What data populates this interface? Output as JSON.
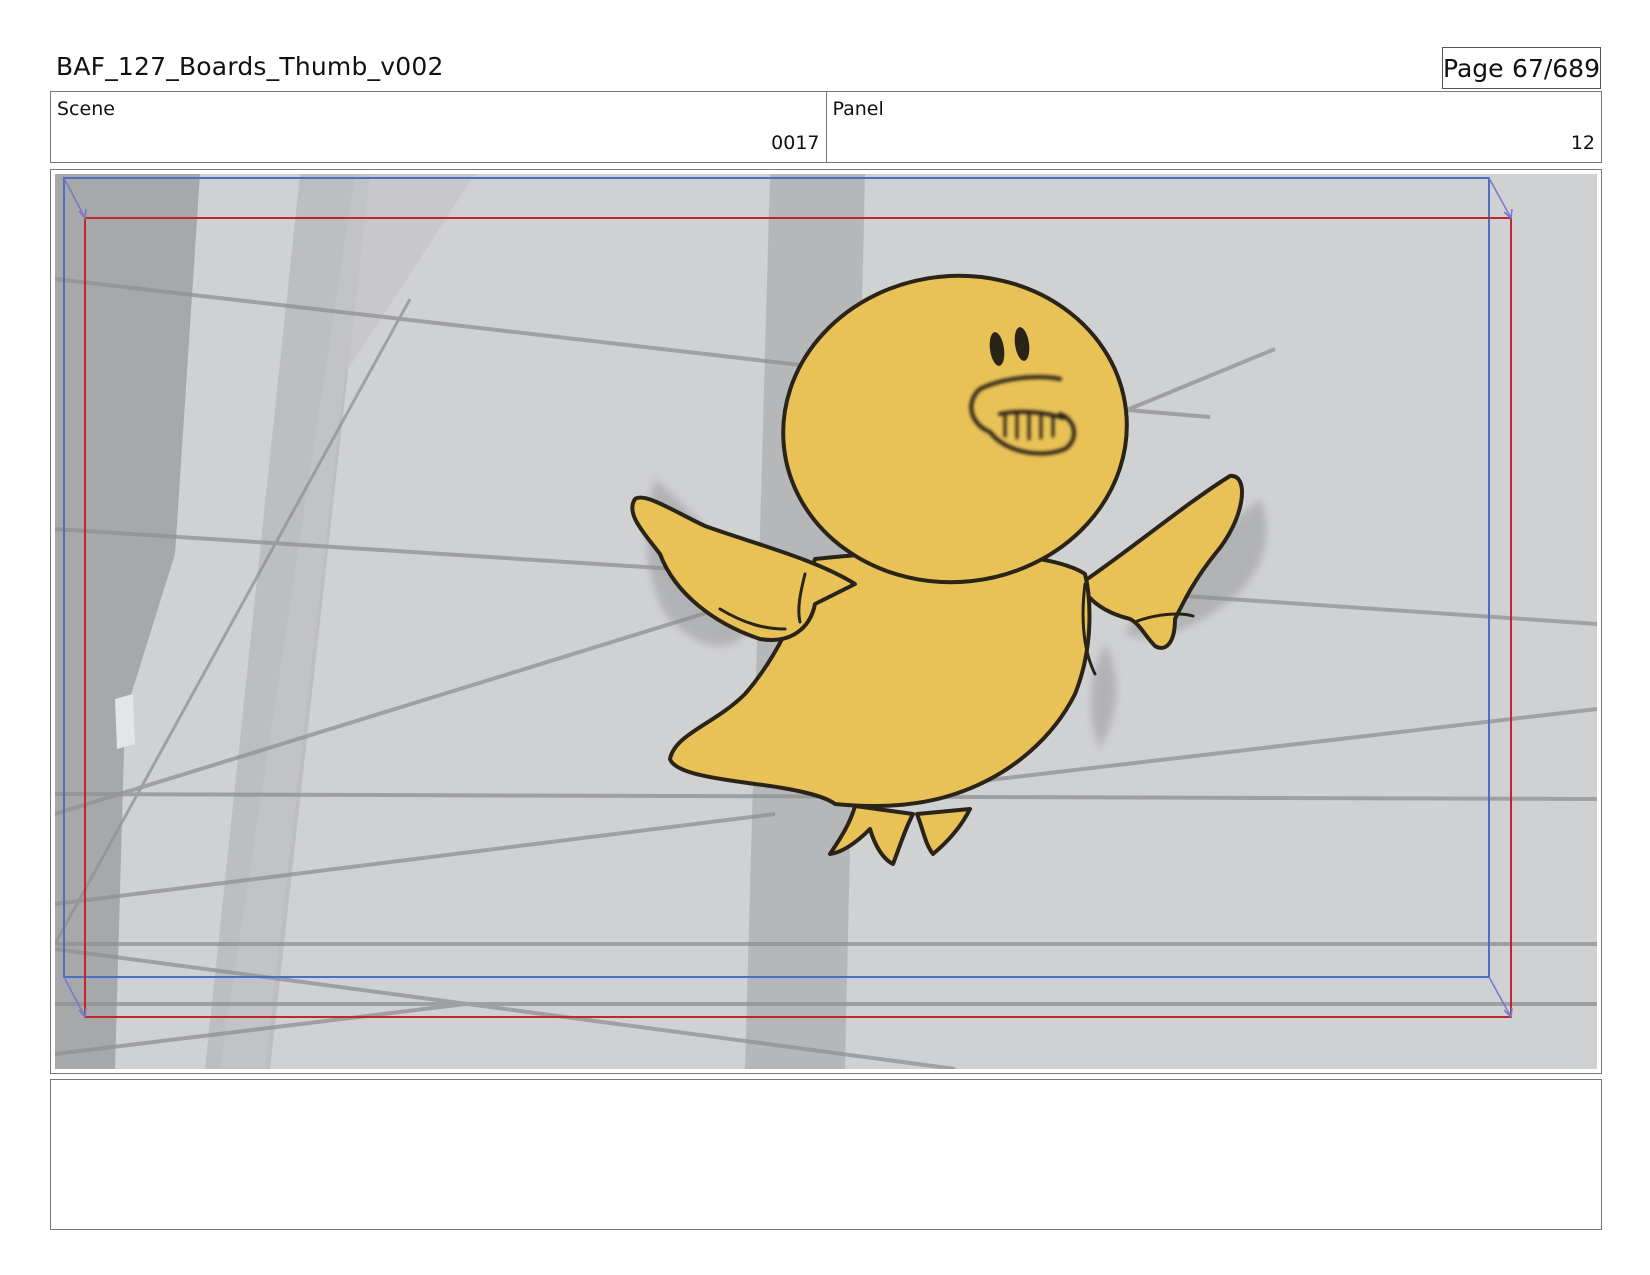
{
  "header": {
    "title": "BAF_127_Boards_Thumb_v002",
    "page_label": "Page",
    "page_value": "67/689"
  },
  "scene": {
    "label": "Scene",
    "value": "0017"
  },
  "panel": {
    "label": "Panel",
    "value": "12"
  },
  "frame": {
    "background_color": "#d0d1d3",
    "character_color": "#e9c257",
    "outline_color": "#2a2418",
    "guide_blue": "#4a6fc4",
    "guide_red": "#c0262e"
  },
  "notes": {
    "text": ""
  }
}
